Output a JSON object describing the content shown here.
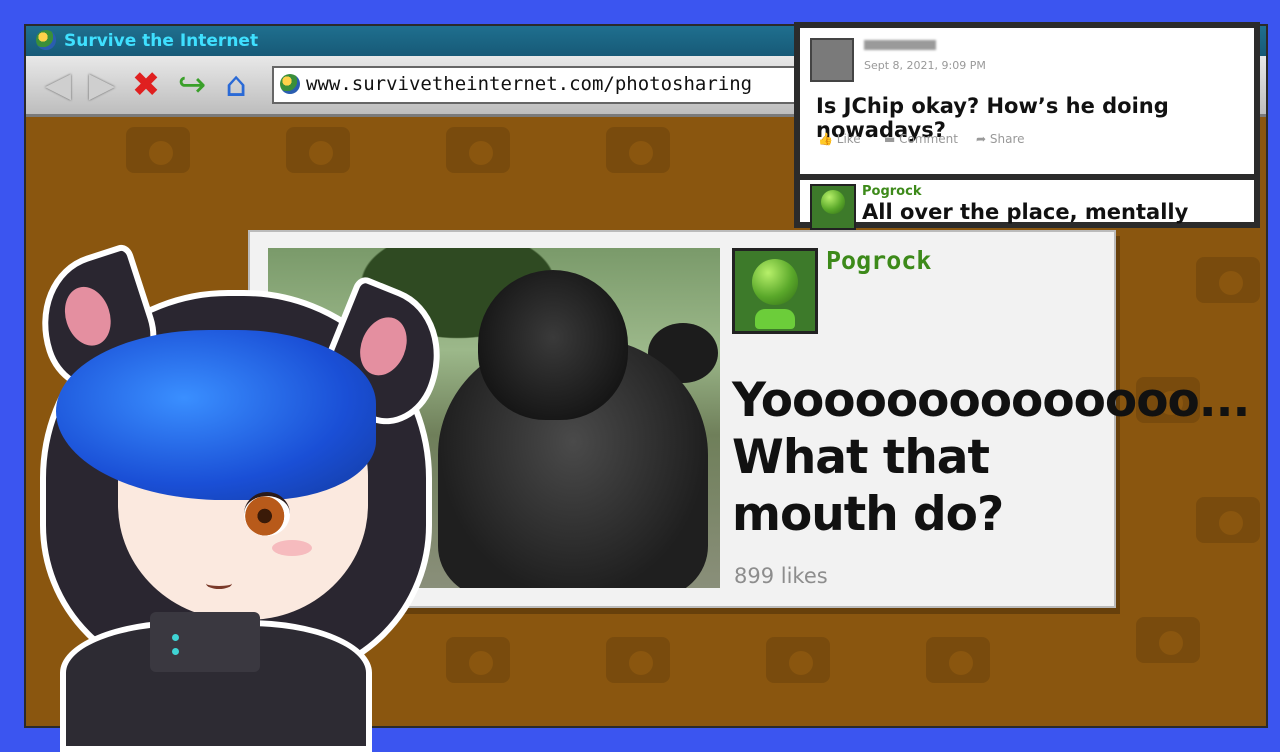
{
  "browser": {
    "title": "Survive the Internet",
    "url": "www.survivetheinternet.com/photosharing",
    "nav_buttons": [
      "back-icon",
      "forward-icon",
      "stop-icon",
      "refresh-icon",
      "home-icon"
    ]
  },
  "post": {
    "username": "Pogrock",
    "caption": "Yoooooooooooooo... What that mouth do?",
    "likes": "899 likes"
  },
  "comments": {
    "top": {
      "date": "Sept 8, 2021, 9:09 PM",
      "text": "Is JChip okay? How’s he doing nowadays?",
      "actions": [
        "Like",
        "Comment",
        "Share"
      ]
    },
    "reply": {
      "username": "Pogrock",
      "text": "All over the place, mentally"
    }
  },
  "colors": {
    "frame_blue": "#3b55f0",
    "page_brown": "#8a560f",
    "username_green": "#3d8a1a"
  }
}
